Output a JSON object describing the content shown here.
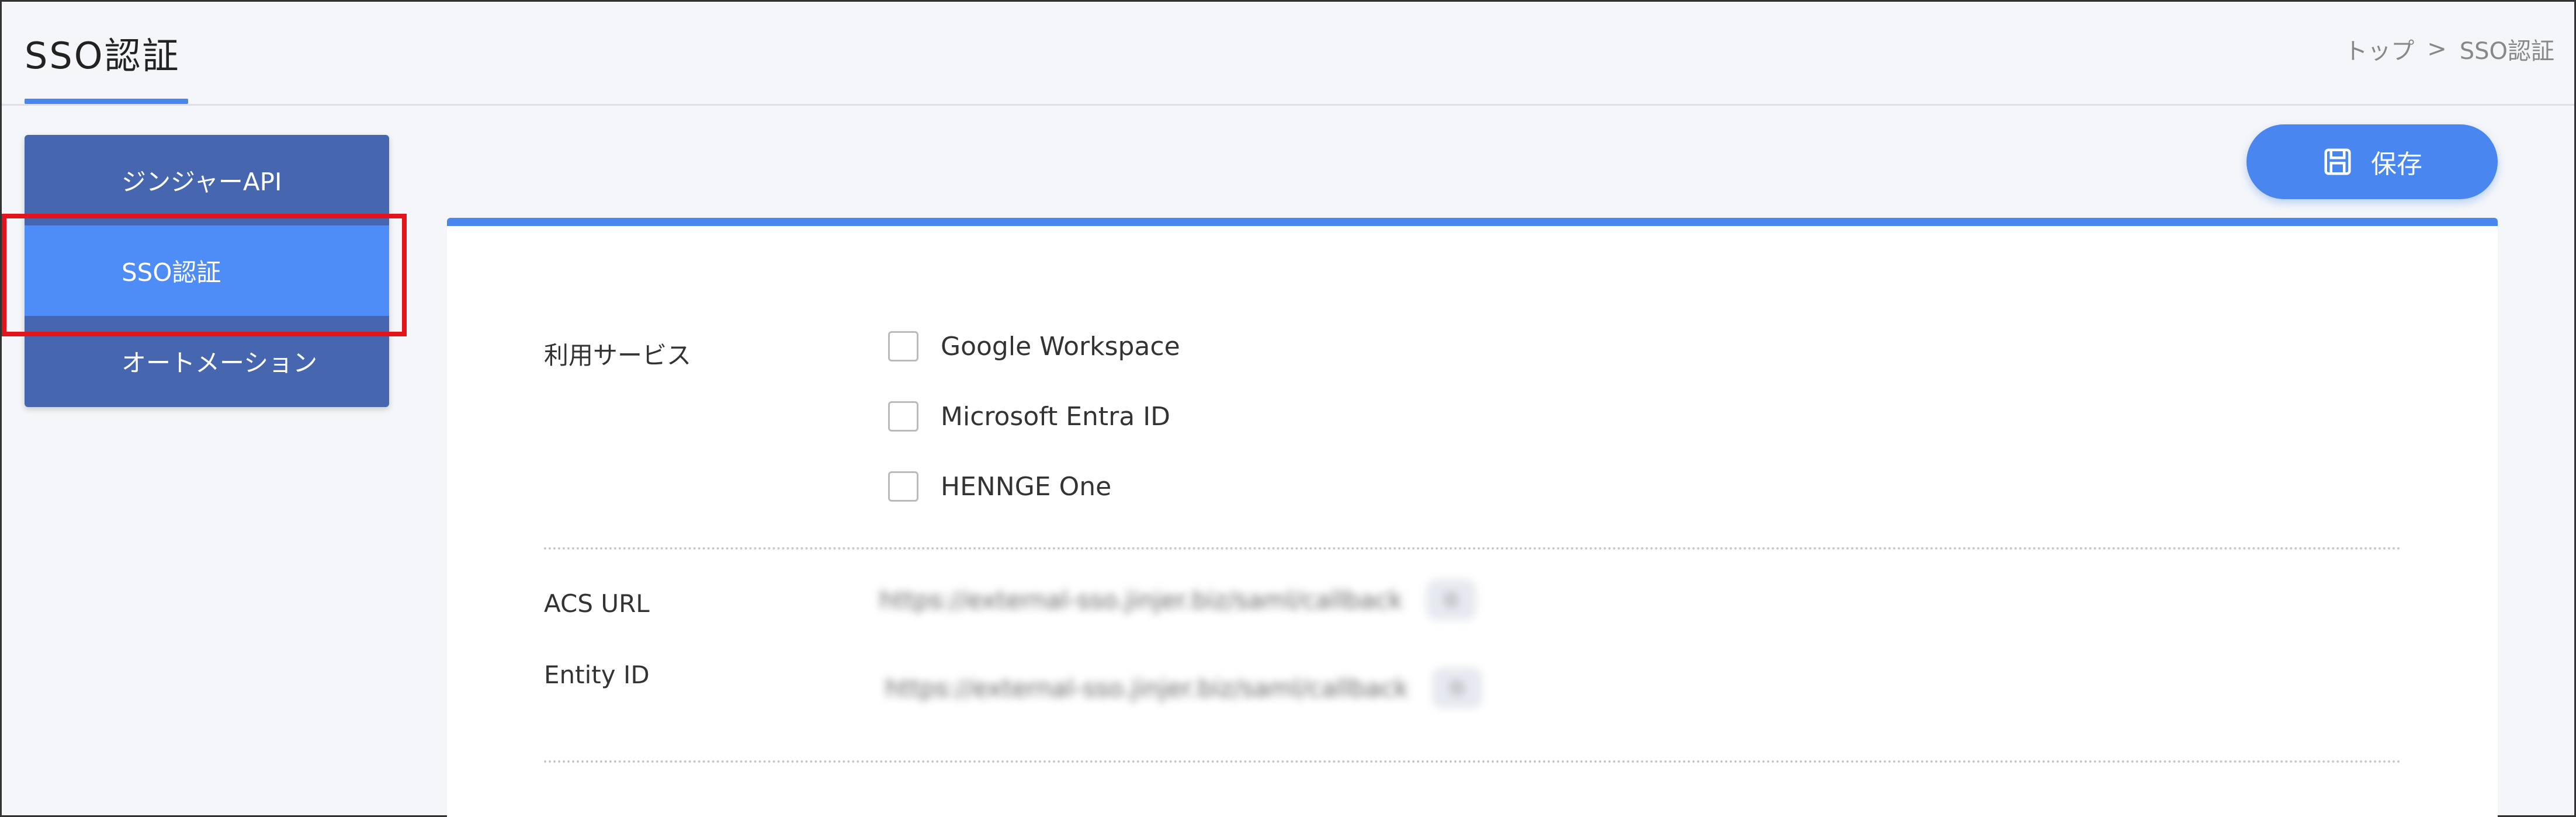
{
  "header": {
    "title": "SSO認証",
    "breadcrumb": [
      "トップ",
      ">",
      "SSO認証"
    ]
  },
  "sidebar": {
    "items": [
      {
        "label": "ジンジャーAPI",
        "active": false
      },
      {
        "label": "SSO認証",
        "active": true
      },
      {
        "label": "オートメーション",
        "active": false
      }
    ]
  },
  "toolbar": {
    "save_label": "保存",
    "save_icon": "floppy-disk-icon"
  },
  "form": {
    "service_label": "利用サービス",
    "services": [
      {
        "label": "Google Workspace",
        "checked": false
      },
      {
        "label": "Microsoft Entra ID",
        "checked": false
      },
      {
        "label": "HENNGE One",
        "checked": false
      }
    ],
    "acs_url_label": "ACS URL",
    "acs_url_value": "https://external-sso.jinjer.biz/saml/callback",
    "entity_id_label": "Entity ID",
    "entity_id_value": "https://external-sso.jinjer.biz/saml/callback"
  },
  "colors": {
    "accent": "#4a86f0",
    "sidebar_bg": "#4667b0",
    "sidebar_active": "#4e8df7",
    "highlight": "#e4141d"
  }
}
